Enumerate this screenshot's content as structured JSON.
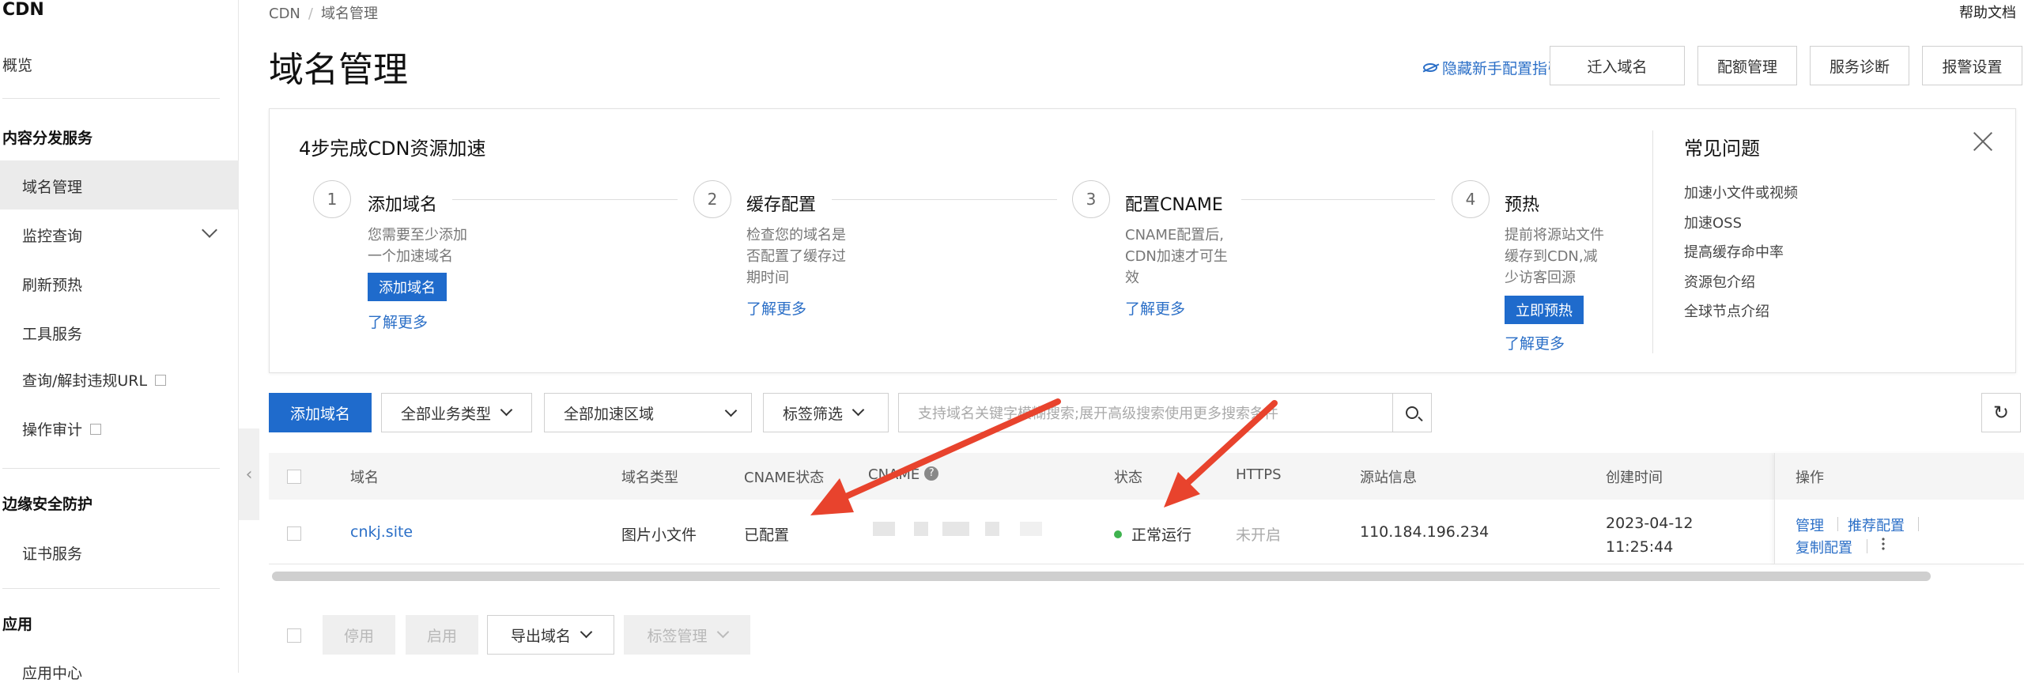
{
  "sidebar": {
    "title": "CDN",
    "overview": "概览",
    "section_content": "内容分发服务",
    "items": [
      {
        "label": "域名管理"
      },
      {
        "label": "监控查询"
      },
      {
        "label": "刷新预热"
      },
      {
        "label": "工具服务"
      },
      {
        "label": "查询/解封违规URL"
      },
      {
        "label": "操作审计"
      }
    ],
    "section_security": "边缘安全防护",
    "cert": "证书服务",
    "section_app": "应用",
    "app_center": "应用中心"
  },
  "header": {
    "breadcrumb": [
      "CDN",
      "域名管理"
    ],
    "breadcrumb_sep": "/",
    "help": "帮助文档",
    "title": "域名管理",
    "hide_guide": "隐藏新手配置指引",
    "buttons": [
      "迁入域名",
      "配额管理",
      "服务诊断",
      "报警设置"
    ]
  },
  "guide": {
    "title": "4步完成CDN资源加速",
    "steps": [
      {
        "num": "1",
        "title": "添加域名",
        "desc": [
          "您需要至少添加",
          "一个加速域名"
        ],
        "button": "添加域名",
        "more": "了解更多"
      },
      {
        "num": "2",
        "title": "缓存配置",
        "desc": [
          "检查您的域名是",
          "否配置了缓存过",
          "期时间"
        ],
        "more": "了解更多"
      },
      {
        "num": "3",
        "title": "配置CNAME",
        "desc": [
          "CNAME配置后,",
          "CDN加速才可生",
          "效"
        ],
        "more": "了解更多"
      },
      {
        "num": "4",
        "title": "预热",
        "desc": [
          "提前将源站文件",
          "缓存到CDN,减",
          "少访客回源"
        ],
        "button": "立即预热",
        "more": "了解更多"
      }
    ],
    "faq": {
      "title": "常见问题",
      "items": [
        "加速小文件或视频",
        "加速OSS",
        "提高缓存命中率",
        "资源包介绍",
        "全球节点介绍"
      ]
    }
  },
  "toolbar": {
    "add_domain": "添加域名",
    "business_type": "全部业务类型",
    "region": "全部加速区域",
    "tag_filter": "标签筛选",
    "search_placeholder": "支持域名关键字模糊搜索;展开高级搜索使用更多搜索条件"
  },
  "table": {
    "headers": {
      "domain": "域名",
      "type": "域名类型",
      "cname_status": "CNAME状态",
      "cname": "CNAME",
      "status": "状态",
      "https": "HTTPS",
      "origin": "源站信息",
      "created": "创建时间",
      "actions": "操作"
    },
    "rows": [
      {
        "domain": "cnkj.site",
        "type": "图片小文件",
        "cname_status": "已配置",
        "status": "正常运行",
        "https": "未开启",
        "origin": "110.184.196.234",
        "created_date": "2023-04-12",
        "created_time": "11:25:44",
        "actions": [
          "管理",
          "推荐配置",
          "复制配置"
        ]
      }
    ]
  },
  "bottom": {
    "disable": "停用",
    "enable": "启用",
    "export": "导出域名",
    "tag_manage": "标签管理"
  },
  "colors": {
    "primary": "#1f6bcc",
    "link": "#2b6fc7",
    "status_ok": "#3fb34f",
    "annotation_arrow": "#e8432d"
  }
}
